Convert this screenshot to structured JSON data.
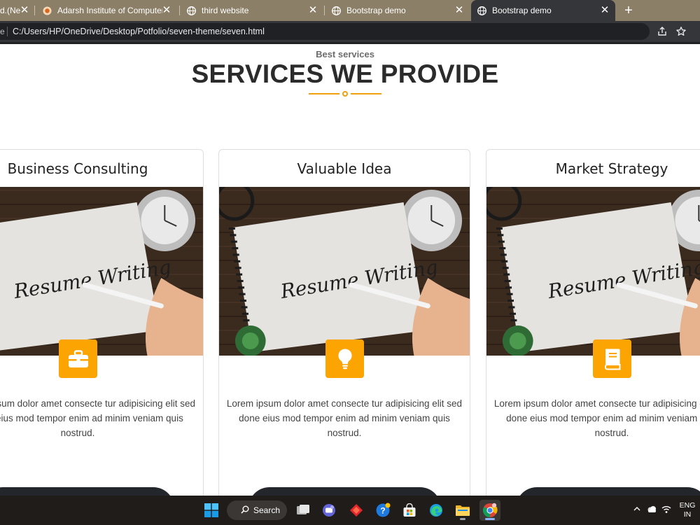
{
  "browser": {
    "tabs": [
      {
        "label": "d.(Ne",
        "icon": "page-icon"
      },
      {
        "label": "Adarsh Institute of Computer Tec",
        "icon": "site-favicon"
      },
      {
        "label": "third website",
        "icon": "globe-icon"
      },
      {
        "label": "Bootstrap demo",
        "icon": "globe-icon"
      },
      {
        "label": "Bootstrap demo",
        "icon": "globe-icon",
        "active": true
      }
    ],
    "address_edge": "e",
    "url": "C:/Users/HP/OneDrive/Desktop/Potfolio/seven-theme/seven.html"
  },
  "page": {
    "eyebrow": "Best services",
    "heading": "SERVICES WE PROVIDE",
    "accent_color": "#fca401",
    "cards": [
      {
        "title": "Business Consulting",
        "icon": "briefcase-icon",
        "image_caption": "Resume Writing",
        "text": "Lorem ipsum dolor amet consecte tur adipisicing elit sed done eius mod tempor enim ad minim veniam quis nostrud."
      },
      {
        "title": "Valuable Idea",
        "icon": "lightbulb-icon",
        "image_caption": "Resume Writing",
        "text": "Lorem ipsum dolor amet consecte tur adipisicing elit sed done eius mod tempor enim ad minim veniam quis nostrud."
      },
      {
        "title": "Market Strategy",
        "icon": "book-icon",
        "image_caption": "Resume Writing",
        "text": "Lorem ipsum dolor amet consecte tur adipisicing elit sed done eius mod tempor enim ad minim veniam quis nostrud."
      }
    ]
  },
  "taskbar": {
    "search_label": "Search",
    "language": "ENG",
    "region": "IN"
  }
}
